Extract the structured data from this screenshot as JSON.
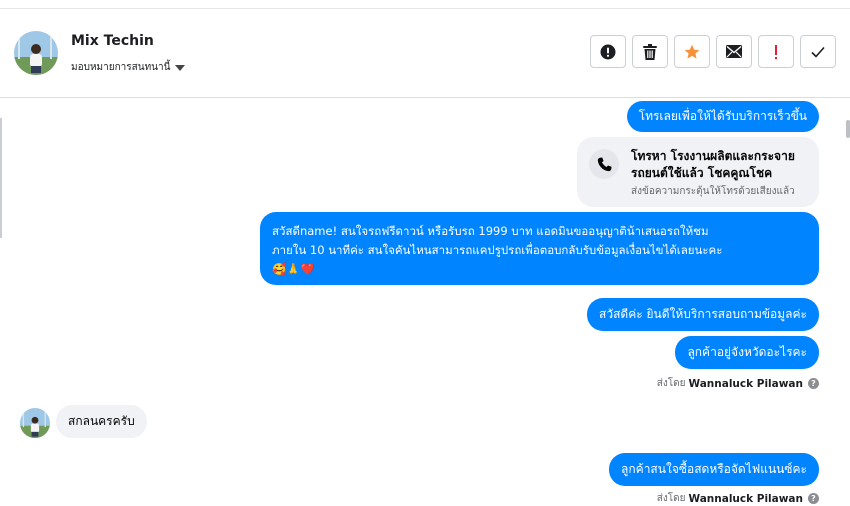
{
  "header": {
    "name": "Mix Techin",
    "assign_label": "มอบหมายการสนทนานี้"
  },
  "actions": [
    {
      "name": "mark-spam-button",
      "icon": "exclamation-circle-icon"
    },
    {
      "name": "delete-button",
      "icon": "trash-icon"
    },
    {
      "name": "star-button",
      "icon": "star-icon"
    },
    {
      "name": "mark-unread-button",
      "icon": "envelope-icon"
    },
    {
      "name": "follow-up-button",
      "icon": "exclamation-icon"
    },
    {
      "name": "mark-done-button",
      "icon": "check-icon"
    }
  ],
  "colors": {
    "outgoing_bubble": "#0084ff",
    "incoming_bubble": "#f0f2f5",
    "star": "#f7923a",
    "follow_up": "#e41e3f"
  },
  "messages": {
    "m1": "โทรเลยเพื่อให้ได้รับบริการเร็วขึ้น",
    "card": {
      "title": "โทรหา โรงงานผลิตและกระจายรถยนต์ใช้แล้ว โชคคูณโชค",
      "subtitle": "ส่งข้อความกระตุ้นให้โทรด้วยเสียงแล้ว",
      "icon": "phone-icon"
    },
    "long": {
      "line1": "สวัสดีname! สนใจรถฟรีดาวน์ หรือรับรถ 1999 บาท แอดมินขออนุญาติน้าเสนอรถให้ชม",
      "line2": "ภายใน 10 นาทีค่ะ สนใจคันไหนสามารถแคปรูปรถเพื่อตอบกลับรับข้อมูลเงื่อนไขได้เลยนะคะ",
      "emoji": "🥰🙏❤️"
    },
    "m3": "สวัสดีค่ะ  ยินดีให้บริการสอบถามข้อมูลค่ะ",
    "m4": "ลูกค้าอยู่จังหวัดอะไรคะ",
    "sent_by_label": "ส่งโดย",
    "sent_by_name": "Wannaluck Pilawan",
    "incoming": "สกลนครครับ",
    "m5": "ลูกค้าสนใจซื้อสดหรือจัดไฟแนนซ์คะ"
  }
}
